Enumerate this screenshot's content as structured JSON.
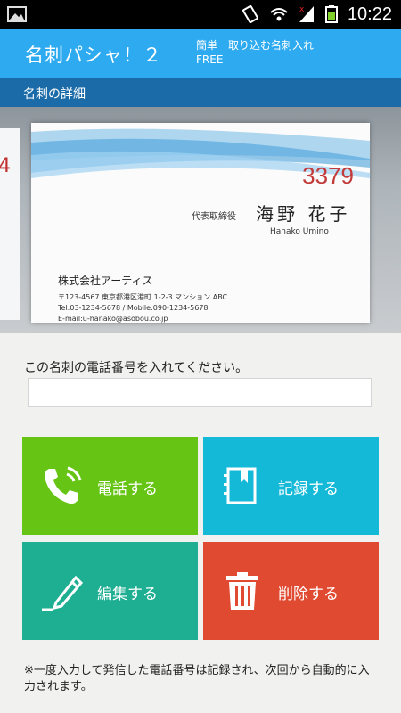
{
  "status_bar": {
    "time": "10:22",
    "icons": [
      "image-icon",
      "vibrate-icon",
      "wifi-icon",
      "signal-icon",
      "battery-icon"
    ]
  },
  "app_bar": {
    "title": "名刺パシャ！２",
    "subtitle_line1": "簡単　取り込む名刺入れ",
    "subtitle_line2": "FREE"
  },
  "section": {
    "label": "名刺の詳細"
  },
  "card_photo": {
    "side_number": "4",
    "number": "3379",
    "role": "代表取締役",
    "name": "海野 花子",
    "name_roman": "Hanako Umino",
    "company": "株式会社アーティス",
    "address_lines": [
      "〒123-4567 東京都港区港町 1-2-3 マンション ABC",
      "Tel:03-1234-5678 / Mobile:090-1234-5678",
      "E-mail:u-hanako@asobou.co.jp"
    ]
  },
  "form": {
    "prompt": "この名刺の電話番号を入れてください。",
    "phone_value": "",
    "phone_placeholder": ""
  },
  "buttons": {
    "call": {
      "label": "電話する",
      "icon": "phone-icon",
      "color": "#66c414"
    },
    "record": {
      "label": "記録する",
      "icon": "notebook-icon",
      "color": "#14b9d8"
    },
    "edit": {
      "label": "編集する",
      "icon": "pencil-icon",
      "color": "#1eae92"
    },
    "delete": {
      "label": "削除する",
      "icon": "trash-icon",
      "color": "#e04a30"
    }
  },
  "note": "※一度入力して発信した電話番号は記録され、次回から自動的に入力されます。"
}
